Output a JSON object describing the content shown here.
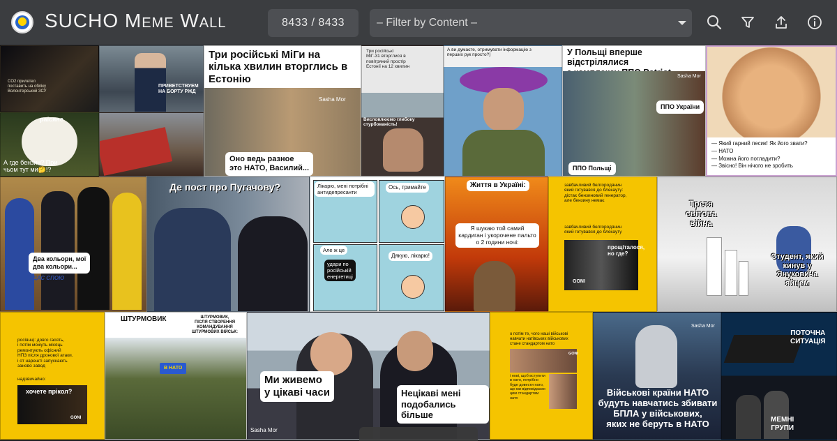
{
  "app": {
    "title": "SUCHO Meme Wall",
    "counter": "8433 / 8433",
    "filter_placeholder": "– Filter by Content –"
  },
  "toolbar": {
    "icons": [
      "search-icon",
      "filter-icon",
      "share-icon",
      "info-icon"
    ]
  },
  "colors": {
    "topbar": "#3b3d40",
    "field": "#4d4f53",
    "accent_yellow": "#f5c400"
  },
  "memes": {
    "m1": {
      "text": "CO2 прилетел\nпоставить на обліку\nВолонтерський ЗСУ"
    },
    "m2": {
      "text": "ПРИВЕТСТВУЕМ\nНА БОРТУ РЖД"
    },
    "m3": {
      "text": "раїсяне",
      "text2": "А где бензин? При\nчьом тут ми🤔!?"
    },
    "m4": {
      "title": "Три російські МіГи на\nкілька хвилин вторглись в\nЕстонію",
      "credit": "Sasha Mor",
      "bubble": "Оно ведь разное\nэто НАТО, Василий..."
    },
    "m5": {
      "text": "Три російські\nМіГ-31 вторглися в\nповітряний простір\nЕстонії на 12 хвилин",
      "text2": "Висловлюємо глибоку стурбованість!"
    },
    "m6": {
      "text": "А ви думаєте, отримувати інформацію з\nперших рук просто?)"
    },
    "m7": {
      "title": "У Польщі вперше відстрілялися\nз комплексу ППО Patriot",
      "credit": "Sasha Mor",
      "label1": "ППО України",
      "label2": "ППО Польщі"
    },
    "m8": {
      "text": "— Який гарний песик! Як його звати?\n— НАТО\n— Можна його погладити?\n— Звісно! Він нічого не зробить"
    },
    "m9": {
      "text": "Два кольори, мої\nдва кольори...",
      "text2": "ЩАС СПОЮ"
    },
    "m10": {
      "text": "Де пост про Пугачову?"
    },
    "m11": {
      "p1": "Лікарю, мені потрібні\nантидепресанти",
      "p2": "Ось, тримайте",
      "p3": "Але ж це",
      "p3b": "удари по\nросійській\nенергетиці",
      "p4": "Дякую, лікарю!"
    },
    "m12": {
      "title": "Життя в Україні:",
      "bubble": "Я шукаю той самий\nкардиган і укорочене пальто\nо 2 години ночі:"
    },
    "m13": {
      "text": "завбачливий белгородянин\nякий готувався до блекауту:\nдістає бензиновий генератор,\nале бензину немає",
      "text2": "завбачливий белгородянин\nякий готувався до блекауту",
      "text3": "прощіталося,\nно где?",
      "brand": "GONI"
    },
    "m14": {
      "text": "Третя\nсвітова\nвійна",
      "text2": "Студент, який\nкинув у\nЯнуковича\nяйцем"
    },
    "m15": {
      "text": "росіянці: довго гасять,\nі потім можуть місяць\nремонтують офісний\nНПЗ після дронової атаки.\nі от нарешті запускають\nзаново завод",
      "text2": "надзвичайно:",
      "text3": "хочете прікол?",
      "brand": "GONI"
    },
    "m16": {
      "title1": "ШТУРМОВИК",
      "title2": "ШТУРМОВИК,\nПІСЛЯ СТВОРЕННЯ\nКОМАНДУВАННЯ\nШТУРМОВИХ ВІЙСЬК:",
      "badge": "В НАТО"
    },
    "m17": {
      "bubble1": "Ми живемо\nу цікаві часи",
      "bubble2": "Нецікаві мені\nподобались більше",
      "credit": "Sasha Mor"
    },
    "m18": {
      "text": "о потім те, чого наші військові\nнавчати натівських військових\nстане стандартом нато",
      "text2": "і нові, щоб вступити\nв нато, потрібно\nбуде довести нато,\nщо ми відповідаємо\nцим стандартам\nнато",
      "brand": "GONI"
    },
    "m19": {
      "text": "Військові країни НАТО\nбудуть навчатись збивати\nБПЛА у військових,\nяких не беруть в НАТО",
      "credit": "Sasha Mor"
    },
    "m20": {
      "text": "ПОТОЧНА\nСИТУАЦІЯ",
      "text2": "МЕМНІ\nГРУПИ"
    }
  }
}
